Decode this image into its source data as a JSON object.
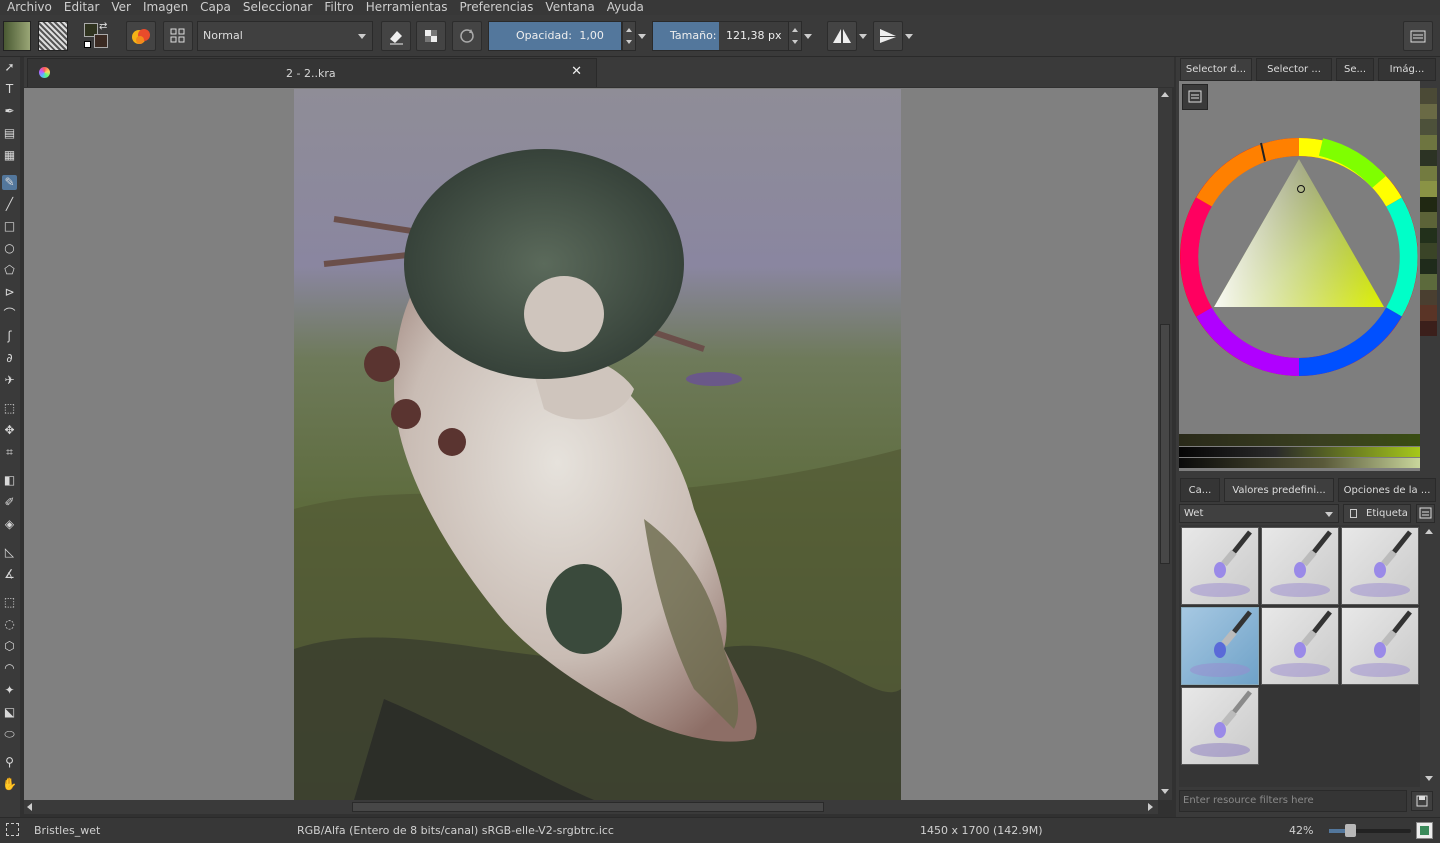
{
  "menu": [
    "Archivo",
    "Editar",
    "Ver",
    "Imagen",
    "Capa",
    "Seleccionar",
    "Filtro",
    "Herramientas",
    "Preferencias",
    "Ventana",
    "Ayuda"
  ],
  "toolbar": {
    "blend_mode": "Normal",
    "opacity_label": "Opacidad:",
    "opacity_value": "1,00",
    "size_label": "Tamaño:",
    "size_value": "121,38 px"
  },
  "document": {
    "tab_title": "2 - 2..kra"
  },
  "docker_tabs": [
    "Selector d...",
    "Selector ...",
    "Se...",
    "Imág..."
  ],
  "preset_tabs": [
    "Ca...",
    "Valores predefini...",
    "Opciones de la ..."
  ],
  "presets": {
    "filter_value": "Wet",
    "tag_label": "Etiqueta",
    "resource_filter_placeholder": "Enter resource filters here",
    "count": 7,
    "selected_index": 3
  },
  "palette_colors": [
    "#4b4a36",
    "#6a6a45",
    "#4d513a",
    "#6e7540",
    "#2c3324",
    "#737b40",
    "#8a9345",
    "#202812",
    "#5c6338",
    "#22301b",
    "#3a4427",
    "#1f2b1b",
    "#5c6a3c",
    "#4a3f30",
    "#5a3426",
    "#3b1f1b"
  ],
  "status": {
    "brush": "Bristles_wet",
    "color_model": "RGB/Alfa (Entero de 8 bits/canal)  sRGB-elle-V2-srgbtrc.icc",
    "dimensions": "1450 x 1700 (142.9M)",
    "zoom": "42%",
    "zoom_fraction": 0.2
  }
}
